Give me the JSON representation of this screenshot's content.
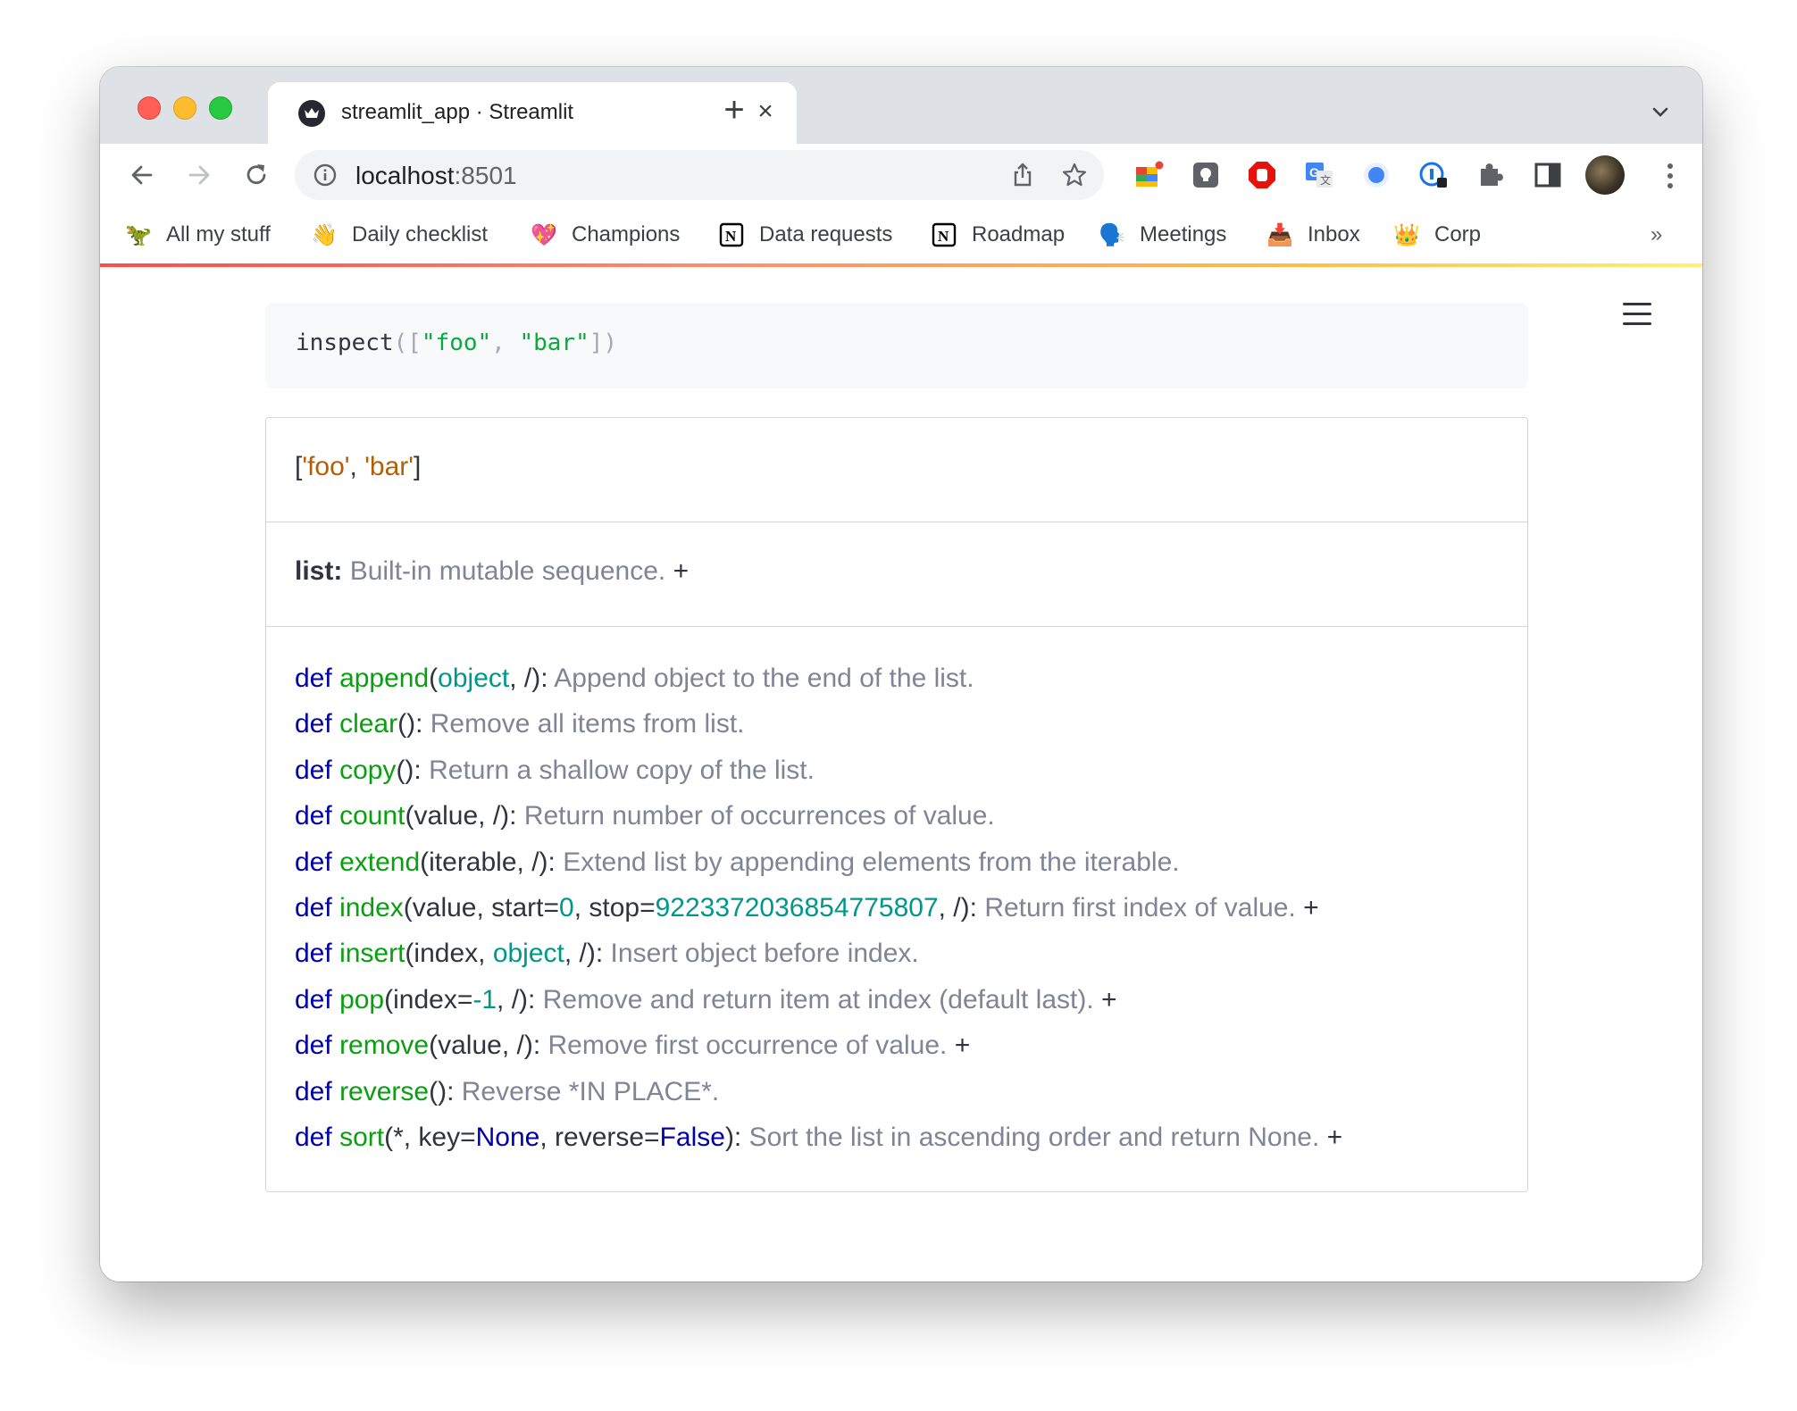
{
  "browser": {
    "tab_title": "streamlit_app · Streamlit",
    "tab_close": "×",
    "new_tab": "+",
    "url_host": "localhost",
    "url_port": ":8501"
  },
  "bookmarks": [
    {
      "label": "All my stuff",
      "icon": "🦖"
    },
    {
      "label": "Daily checklist",
      "icon": "👋"
    },
    {
      "label": "Champions",
      "icon": "💖"
    },
    {
      "label": "Data requests",
      "icon": "notion-icon"
    },
    {
      "label": "Roadmap",
      "icon": "notion-icon"
    },
    {
      "label": "Meetings",
      "icon": "🗣️"
    },
    {
      "label": "Inbox",
      "icon": "📥"
    },
    {
      "label": "Corp",
      "icon": "👑"
    }
  ],
  "bookmarks_more": "»",
  "code": {
    "fn": "inspect",
    "open": "([",
    "s1": "\"foo\"",
    "comma": ", ",
    "s2": "\"bar\"",
    "close": "])"
  },
  "inspect": {
    "repr_open": "[",
    "repr_item1": "'foo'",
    "repr_sep": ", ",
    "repr_item2": "'bar'",
    "repr_close": "]",
    "type_name": "list:",
    "type_doc": "Built-in mutable sequence.",
    "type_expand": "+",
    "methods": [
      {
        "kw": "def",
        "name": "append",
        "sig_html": "(<span class=\"obj\">object</span>, /): ",
        "doc": "Append object to the end of the list.",
        "more": ""
      },
      {
        "kw": "def",
        "name": "clear",
        "sig_html": "(): ",
        "doc": "Remove all items from list.",
        "more": ""
      },
      {
        "kw": "def",
        "name": "copy",
        "sig_html": "(): ",
        "doc": "Return a shallow copy of the list.",
        "more": ""
      },
      {
        "kw": "def",
        "name": "count",
        "sig_html": "(value, /): ",
        "doc": "Return number of occurrences of value.",
        "more": ""
      },
      {
        "kw": "def",
        "name": "extend",
        "sig_html": "(iterable, /): ",
        "doc": "Extend list by appending elements from the iterable.",
        "more": ""
      },
      {
        "kw": "def",
        "name": "index",
        "sig_html": "(value, start=<span class=\"num\">0</span>, stop=<span class=\"num\">9223372036854775807</span>, /): ",
        "doc": "Return first index of value.",
        "more": "+"
      },
      {
        "kw": "def",
        "name": "insert",
        "sig_html": "(index, <span class=\"obj\">object</span>, /): ",
        "doc": "Insert object before index.",
        "more": ""
      },
      {
        "kw": "def",
        "name": "pop",
        "sig_html": "(index=<span class=\"num\">-1</span>, /): ",
        "doc": "Remove and return item at index (default last).",
        "more": "+"
      },
      {
        "kw": "def",
        "name": "remove",
        "sig_html": "(value, /): ",
        "doc": "Remove first occurrence of value.",
        "more": "+"
      },
      {
        "kw": "def",
        "name": "reverse",
        "sig_html": "(): ",
        "doc": "Reverse *IN PLACE*.",
        "more": ""
      },
      {
        "kw": "def",
        "name": "sort",
        "sig_html": "(*, key=<span class=\"const\">None</span>, reverse=<span class=\"const\">False</span>): ",
        "doc": "Sort the list in ascending order and return None.",
        "more": "+"
      }
    ]
  }
}
